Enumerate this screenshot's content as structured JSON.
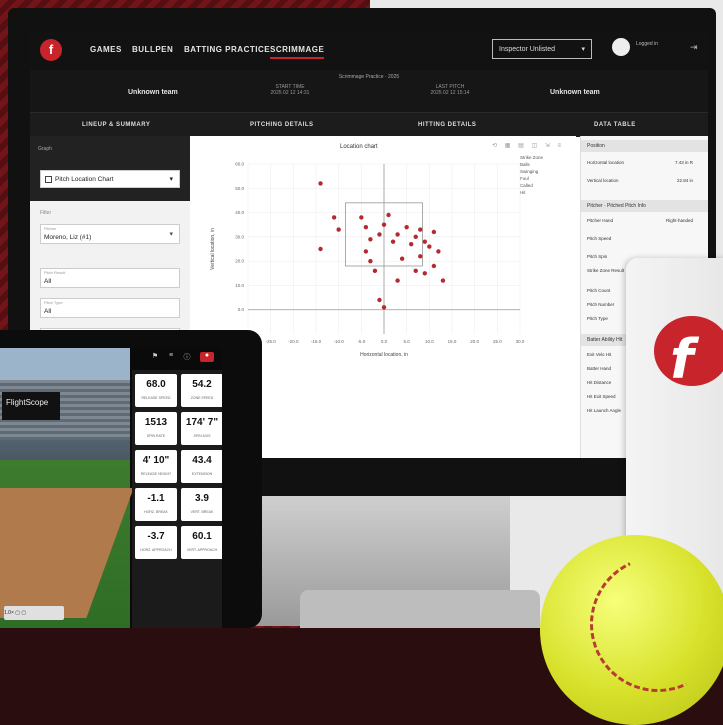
{
  "nav": {
    "items": [
      "GAMES",
      "BULLPEN",
      "BATTING PRACTICE",
      "SCRIMMAGE"
    ],
    "active": "SCRIMMAGE",
    "session_select": "Inspector Unlisted"
  },
  "header": {
    "subtitle": "Scrimmage Practice · 2025",
    "home_team": "Unknown team",
    "away_team": "Unknown team",
    "left_meta_label": "START TIME",
    "left_meta_value": "2025 02 12 14:31",
    "right_meta_label": "LAST PITCH",
    "right_meta_value": "2025 02 12 15:14"
  },
  "tabs": [
    "LINEUP & SUMMARY",
    "PITCHING DETAILS",
    "HITTING DETAILS",
    "DATA TABLE"
  ],
  "sidebar": {
    "header_label": "Graph",
    "graph_select": "Pitch Location Chart",
    "filters_label": "Filter",
    "fields": [
      {
        "label": "Pitcher",
        "value": "Moreno, Liz (#1)"
      },
      {
        "label": "Pitch Result",
        "value": "All"
      },
      {
        "label": "Pitch Type",
        "value": "All"
      },
      {
        "label": "Game",
        "value": ""
      }
    ]
  },
  "chart": {
    "title": "Location chart",
    "xlabel": "Horizontal location, in",
    "ylabel": "Vertical location, in",
    "legend": [
      "Strike Zone",
      "Balls",
      "Swinging",
      "Foul",
      "Called",
      "Hit"
    ],
    "tools": "⟲ ▦ ▤ ◫ ⇲ ≡"
  },
  "chart_data": {
    "type": "scatter",
    "title": "Location chart",
    "xlabel": "Horizontal location, in",
    "ylabel": "Vertical location, in",
    "xlim": [
      -30,
      30
    ],
    "ylim": [
      -10,
      60
    ],
    "strike_zone": {
      "x": [
        -8.5,
        8.5
      ],
      "y": [
        18,
        44
      ]
    },
    "x_ticks": [
      -30,
      -25,
      -20,
      -15,
      -10,
      -5,
      0,
      5,
      10,
      15,
      20,
      25,
      30
    ],
    "y_ticks": [
      0,
      10,
      20,
      30,
      40,
      50,
      60
    ],
    "grid": true,
    "points": [
      {
        "x": -14,
        "y": 52
      },
      {
        "x": -11,
        "y": 38
      },
      {
        "x": -10,
        "y": 33
      },
      {
        "x": -14,
        "y": 25
      },
      {
        "x": -5,
        "y": 38
      },
      {
        "x": -4,
        "y": 34
      },
      {
        "x": -3,
        "y": 29
      },
      {
        "x": -4,
        "y": 24
      },
      {
        "x": -3,
        "y": 20
      },
      {
        "x": -2,
        "y": 16
      },
      {
        "x": -1,
        "y": 31
      },
      {
        "x": 0,
        "y": 35
      },
      {
        "x": 1,
        "y": 39
      },
      {
        "x": 2,
        "y": 28
      },
      {
        "x": 3,
        "y": 31
      },
      {
        "x": 4,
        "y": 21
      },
      {
        "x": 5,
        "y": 34
      },
      {
        "x": 6,
        "y": 27
      },
      {
        "x": 7,
        "y": 30
      },
      {
        "x": 8,
        "y": 22
      },
      {
        "x": 9,
        "y": 28
      },
      {
        "x": 10,
        "y": 26
      },
      {
        "x": 11,
        "y": 32
      },
      {
        "x": 12,
        "y": 24
      },
      {
        "x": 7,
        "y": 16
      },
      {
        "x": 9,
        "y": 15
      },
      {
        "x": 11,
        "y": 18
      },
      {
        "x": 13,
        "y": 12
      },
      {
        "x": 3,
        "y": 12
      },
      {
        "x": -1,
        "y": 4
      },
      {
        "x": 0,
        "y": 1
      },
      {
        "x": 8,
        "y": 33
      }
    ]
  },
  "right_panel": {
    "position_head": "Position",
    "rows": [
      {
        "label": "Horizontal location",
        "value": "7.43 in R"
      },
      {
        "label": "Vertical location",
        "value": "22.84 in"
      }
    ],
    "pitcher_head": "Pitcher · Pitched Pitch Info",
    "pitcher_rows": [
      {
        "label": "Pitcher Hand",
        "value": "Right-handed"
      },
      {
        "label": "Pitch Speed",
        "value": ""
      },
      {
        "label": "Pitch Spin",
        "value": ""
      },
      {
        "label": "Strike Zone Result",
        "value": ""
      },
      {
        "label": "Pitch Count",
        "value": ""
      },
      {
        "label": "Pitch Number",
        "value": ""
      },
      {
        "label": "Pitch Type",
        "value": ""
      }
    ],
    "batter_head": "Batter Ability Hit",
    "batter_rows": [
      "Exit Velo Hit",
      "Batter Hand",
      "Hit Distance",
      "Hit Exit Speed",
      "Hit Launch Angle"
    ]
  },
  "tablet": {
    "scoreboard": "FlightScope",
    "controls": "1.0× ▢ ▢",
    "metrics": [
      {
        "value": "68.0",
        "label": "RELEASE SPEED"
      },
      {
        "value": "54.2",
        "label": "ZONE SPEED"
      },
      {
        "value": "1513",
        "label": "SPIN RATE"
      },
      {
        "value": "174' 7\"",
        "label": "SPIN AXIS"
      },
      {
        "value": "4' 10\"",
        "label": "RELEASE HEIGHT"
      },
      {
        "value": "43.4",
        "label": "EXTENSION"
      },
      {
        "value": "-1.1",
        "label": "HORZ. BREAK"
      },
      {
        "value": "3.9",
        "label": "VERT. BREAK"
      },
      {
        "value": "-3.7",
        "label": "HORZ. APPROACH"
      },
      {
        "value": "60.1",
        "label": "VERT. APPROACH"
      }
    ]
  },
  "colors": {
    "accent": "#c8242c",
    "ball_yellow": "#e4ed3a",
    "point": "#b32a2f"
  }
}
